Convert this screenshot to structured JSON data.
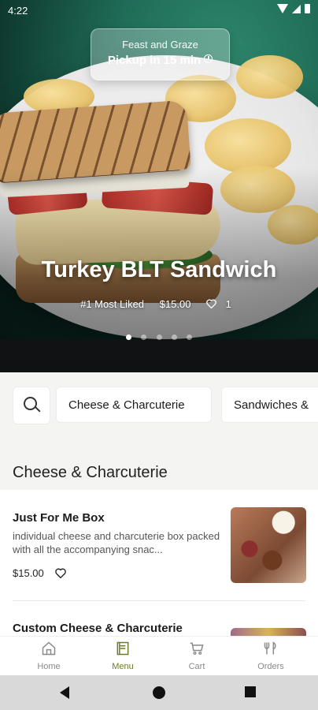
{
  "status_bar": {
    "time": "4:22"
  },
  "hero": {
    "venue": "Feast and Graze",
    "pickup": "Pickup in 15 min",
    "title": "Turkey BLT Sandwich",
    "badge": "#1 Most Liked",
    "price": "$15.00",
    "likes": "1",
    "slides_total": 5,
    "slide_active": 1
  },
  "categories": {
    "items": [
      "Cheese & Charcuterie",
      "Sandwiches &"
    ]
  },
  "section": {
    "title": "Cheese & Charcuterie"
  },
  "menu_items": [
    {
      "name": "Just For Me Box",
      "description": "individual cheese and charcuterie box packed with all the accompanying snac...",
      "price": "$15.00"
    },
    {
      "name": "Custom Cheese & Charcuterie"
    }
  ],
  "bottom_nav": {
    "items": [
      "Home",
      "Menu",
      "Cart",
      "Orders"
    ],
    "active": "Menu",
    "active_color": "#6c7a2a"
  },
  "icons": [
    "search-icon",
    "heart-icon",
    "clock-icon",
    "home-icon",
    "menu-icon",
    "cart-icon",
    "orders-icon"
  ]
}
